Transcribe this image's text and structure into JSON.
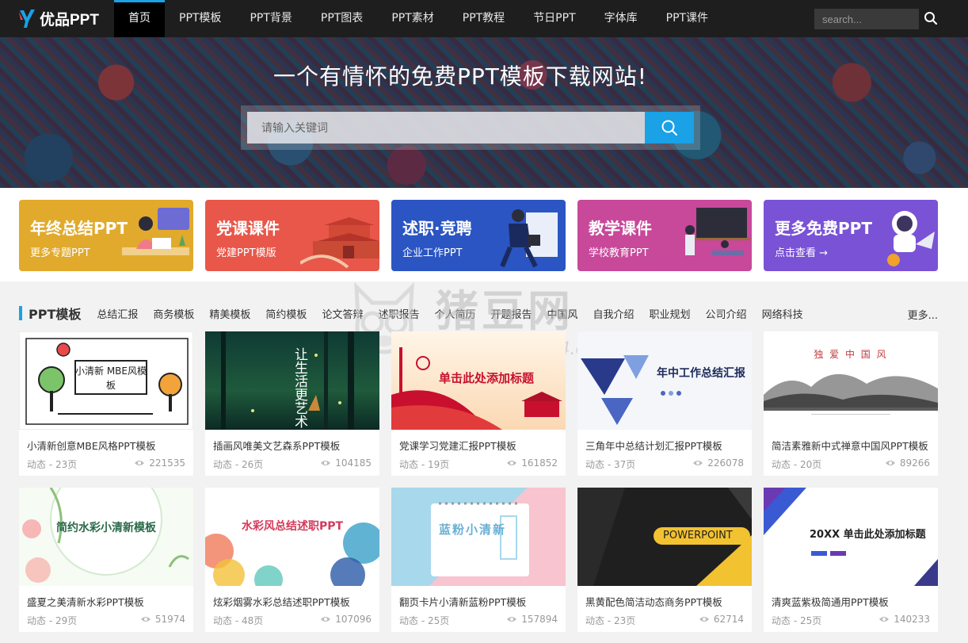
{
  "nav": {
    "logo_text": "优品PPT",
    "items": [
      {
        "label": "首页",
        "active": true
      },
      {
        "label": "PPT模板"
      },
      {
        "label": "PPT背景"
      },
      {
        "label": "PPT图表"
      },
      {
        "label": "PPT素材"
      },
      {
        "label": "PPT教程"
      },
      {
        "label": "节日PPT"
      },
      {
        "label": "字体库"
      },
      {
        "label": "PPT课件"
      }
    ],
    "search_placeholder": "search..."
  },
  "hero": {
    "title": "一个有情怀的免费PPT模板下载网站!",
    "search_placeholder": "请输入关键词"
  },
  "banners": [
    {
      "title": "年终总结PPT",
      "sub": "更多专题PPT",
      "color": "#e1aa2c"
    },
    {
      "title": "党课课件",
      "sub": "党建PPT模版",
      "color": "#e8574a"
    },
    {
      "title": "述职·竞聘",
      "sub": "企业工作PPT",
      "color": "#2a55c3"
    },
    {
      "title": "教学课件",
      "sub": "学校教育PPT",
      "color": "#c8489a"
    },
    {
      "title": "更多免费PPT",
      "sub": "点击查看 →",
      "color": "#7a52d6"
    }
  ],
  "section": {
    "title": "PPT模板",
    "tabs": [
      "总结汇报",
      "商务模板",
      "精美模板",
      "简约模板",
      "论文答辩",
      "述职报告",
      "个人简历",
      "开题报告",
      "中国风",
      "自我介绍",
      "职业规划",
      "公司介绍",
      "网络科技"
    ],
    "more": "更多..."
  },
  "watermark": {
    "text": "猪豆网",
    "url": "www.97444.cn"
  },
  "cards": [
    {
      "title": "小清新创意MBE风格PPT模板",
      "meta": "动态 - 23页",
      "views": "221535",
      "thumb_text": "小清新 MBE风模板"
    },
    {
      "title": "插画风唯美文艺森系PPT模板",
      "meta": "动态 - 26页",
      "views": "104185",
      "thumb_text": "让生活更艺术"
    },
    {
      "title": "党课学习党建汇报PPT模板",
      "meta": "动态 - 19页",
      "views": "161852",
      "thumb_text": "单击此处添加标题"
    },
    {
      "title": "三角年中总结计划汇报PPT模板",
      "meta": "动态 - 37页",
      "views": "226078",
      "thumb_text": "年中工作总结汇报"
    },
    {
      "title": "简洁素雅新中式禅意中国风PPT模板",
      "meta": "动态 - 20页",
      "views": "89266",
      "thumb_text": "独 爱 中 国 风"
    },
    {
      "title": "盛夏之美清新水彩PPT模板",
      "meta": "动态 - 29页",
      "views": "51974",
      "thumb_text": "简约水彩小清新模板"
    },
    {
      "title": "炫彩烟雾水彩总结述职PPT模板",
      "meta": "动态 - 48页",
      "views": "107096",
      "thumb_text": "水彩风总结述职PPT"
    },
    {
      "title": "翻页卡片小清新蓝粉PPT模板",
      "meta": "动态 - 25页",
      "views": "157894",
      "thumb_text": "蓝粉小清新"
    },
    {
      "title": "黑黄配色简洁动态商务PPT模板",
      "meta": "动态 - 23页",
      "views": "62714",
      "thumb_text": "POWERPOINT"
    },
    {
      "title": "清爽蓝紫极简通用PPT模板",
      "meta": "动态 - 25页",
      "views": "140233",
      "thumb_text": "20XX 单击此处添加标题"
    }
  ]
}
